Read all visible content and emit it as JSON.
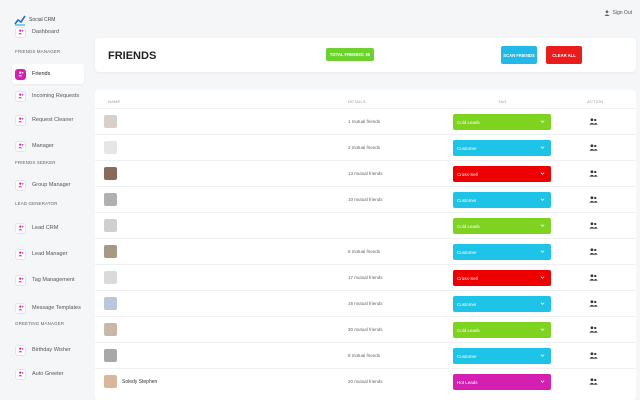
{
  "app": {
    "logo_text": "Social CRM",
    "signout_label": "Sign Out"
  },
  "sidebar": {
    "items": [
      {
        "label": "Dashboard",
        "active": false
      },
      {
        "section": "FRIENDS MANAGER"
      },
      {
        "label": "Friends",
        "active": true
      },
      {
        "label": "Incoming Requests",
        "active": false
      },
      {
        "label": "Request Cleaner",
        "active": false
      },
      {
        "label": "Manager",
        "active": false
      },
      {
        "section": "FRIENDS SEEKER"
      },
      {
        "label": "Group Manager",
        "active": false
      },
      {
        "section": "LEAD GENERATOR"
      },
      {
        "label": "Lead CRM",
        "active": false
      },
      {
        "label": "Lead Manager",
        "active": false
      },
      {
        "label": "Tag Management",
        "active": false
      },
      {
        "label": "Message Templates",
        "active": false
      },
      {
        "section": "GREETING MANAGER"
      },
      {
        "label": "Birthday Wisher",
        "active": false
      },
      {
        "label": "Auto Greeter",
        "active": false
      }
    ]
  },
  "header": {
    "title": "FRIENDS",
    "total_label": "TOTAL FRIENDS: 65",
    "scan_label": "SCAN FRIENDS",
    "clear_label": "CLEAR ALL"
  },
  "table": {
    "columns": {
      "name": "NAME",
      "details": "DETAILS",
      "tag": "TAG",
      "action": "ACTION"
    },
    "rows": [
      {
        "name": "",
        "details": "1 mutual friends",
        "tag": "Cold Leads",
        "color": "#7ed321"
      },
      {
        "name": "",
        "details": "2 mutual friends",
        "tag": "Customer",
        "color": "#1ec3e8"
      },
      {
        "name": "",
        "details": "13 mutual friends",
        "tag": "Cross-Sell",
        "color": "#ee0000"
      },
      {
        "name": "",
        "details": "10 mutual friends",
        "tag": "Customer",
        "color": "#1ec3e8"
      },
      {
        "name": "",
        "details": "",
        "tag": "Cold Leads",
        "color": "#7ed321"
      },
      {
        "name": "",
        "details": "6 mutual friends",
        "tag": "Customer",
        "color": "#1ec3e8"
      },
      {
        "name": "",
        "details": "17 mutual friends",
        "tag": "Cross-Sell",
        "color": "#ee0000"
      },
      {
        "name": "",
        "details": "16 mutual friends",
        "tag": "Customer",
        "color": "#1ec3e8"
      },
      {
        "name": "",
        "details": "30 mutual friends",
        "tag": "Cold Leads",
        "color": "#7ed321"
      },
      {
        "name": "",
        "details": "8 mutual friends",
        "tag": "Customer",
        "color": "#1ec3e8"
      },
      {
        "name": "Soledy Stephen",
        "details": "20 mutual friends",
        "tag": "Hot Leads",
        "color": "#d41fb0"
      }
    ]
  },
  "colors": {
    "accent": "#d41fb0",
    "total": "#6bd22e",
    "scan": "#22b8e8",
    "clear": "#ea1c1c"
  },
  "icons": {
    "logo": "chart-logo-icon",
    "signout": "user-icon",
    "sidebar": "user-plus-icon",
    "action": "add-friend-icon",
    "tag_dropdown": "chevron-down-icon"
  }
}
